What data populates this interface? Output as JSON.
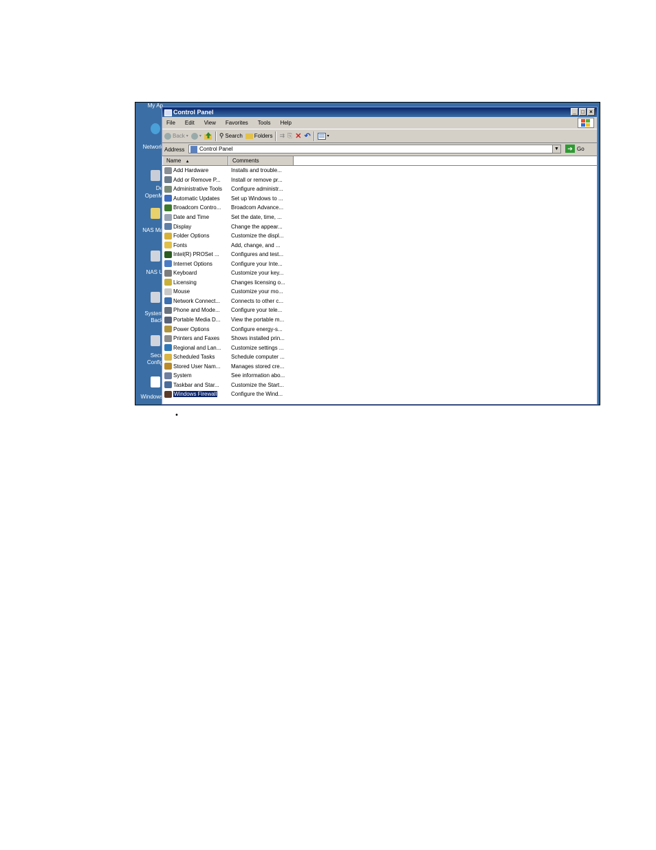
{
  "desktop": {
    "items": [
      "My Ap",
      "Network",
      "De",
      "OpenM",
      "NAS Ma",
      "NAS U",
      "System",
      "Back",
      "Secu",
      "Config",
      "Windows"
    ]
  },
  "window": {
    "title": "Control Panel",
    "controls": [
      "_",
      "□",
      "×"
    ]
  },
  "menu": [
    "File",
    "Edit",
    "View",
    "Favorites",
    "Tools",
    "Help"
  ],
  "toolbar": {
    "back": "Back",
    "search": "Search",
    "folders": "Folders"
  },
  "address": {
    "label": "Address",
    "value": "Control Panel",
    "go": "Go"
  },
  "columns": {
    "name": "Name",
    "comments": "Comments"
  },
  "items": [
    {
      "name": "Add Hardware",
      "comment": "Installs and trouble...",
      "icon": "hardware-icon",
      "color": "#8a8f96"
    },
    {
      "name": "Add or Remove P...",
      "comment": "Install or remove pr...",
      "icon": "add-remove-icon",
      "color": "#6d7d8c"
    },
    {
      "name": "Administrative Tools",
      "comment": "Configure administr...",
      "icon": "admin-tools-icon",
      "color": "#7b8b7b"
    },
    {
      "name": "Automatic Updates",
      "comment": "Set up Windows to ...",
      "icon": "updates-icon",
      "color": "#3d6cc0"
    },
    {
      "name": "Broadcom Contro...",
      "comment": "Broadcom Advance...",
      "icon": "broadcom-icon",
      "color": "#3c7a2d"
    },
    {
      "name": "Date and Time",
      "comment": "Set the date, time, ...",
      "icon": "clock-icon",
      "color": "#9aa4b2"
    },
    {
      "name": "Display",
      "comment": "Change the appear...",
      "icon": "display-icon",
      "color": "#5f7fa8"
    },
    {
      "name": "Folder Options",
      "comment": "Customize the displ...",
      "icon": "folder-options-icon",
      "color": "#d6b13a"
    },
    {
      "name": "Fonts",
      "comment": "Add, change, and ...",
      "icon": "fonts-icon",
      "color": "#e0c04a"
    },
    {
      "name": "Intel(R) PROSet ...",
      "comment": "Configures and test...",
      "icon": "intel-icon",
      "color": "#2c5b22"
    },
    {
      "name": "Internet Options",
      "comment": "Configure your Inte...",
      "icon": "internet-icon",
      "color": "#4b7bc4"
    },
    {
      "name": "Keyboard",
      "comment": "Customize your key...",
      "icon": "keyboard-icon",
      "color": "#7d7d7d"
    },
    {
      "name": "Licensing",
      "comment": "Changes licensing o...",
      "icon": "licensing-icon",
      "color": "#c9b03b"
    },
    {
      "name": "Mouse",
      "comment": "Customize your mo...",
      "icon": "mouse-icon",
      "color": "#c8c8c8"
    },
    {
      "name": "Network Connect...",
      "comment": "Connects to other c...",
      "icon": "network-icon",
      "color": "#3b6fb0"
    },
    {
      "name": "Phone and Mode...",
      "comment": "Configure your tele...",
      "icon": "phone-icon",
      "color": "#6a7280"
    },
    {
      "name": "Portable Media D...",
      "comment": "View the portable m...",
      "icon": "media-icon",
      "color": "#58637a"
    },
    {
      "name": "Power Options",
      "comment": "Configure energy-s...",
      "icon": "power-icon",
      "color": "#b09440"
    },
    {
      "name": "Printers and Faxes",
      "comment": "Shows installed prin...",
      "icon": "printer-icon",
      "color": "#8c8c8c"
    },
    {
      "name": "Regional and Lan...",
      "comment": "Customize settings ...",
      "icon": "globe-icon",
      "color": "#2f78b8"
    },
    {
      "name": "Scheduled Tasks",
      "comment": "Schedule computer ...",
      "icon": "tasks-icon",
      "color": "#d8b444"
    },
    {
      "name": "Stored User Nam...",
      "comment": "Manages stored cre...",
      "icon": "keys-icon",
      "color": "#b88a2a"
    },
    {
      "name": "System",
      "comment": "See information abo...",
      "icon": "system-icon",
      "color": "#6f7fa0"
    },
    {
      "name": "Taskbar and Star...",
      "comment": "Customize the Start...",
      "icon": "taskbar-icon",
      "color": "#4a6c9a"
    },
    {
      "name": "Windows Firewall",
      "comment": "Configure the Wind...",
      "icon": "firewall-icon",
      "color": "#5a3a2a",
      "selected": true
    }
  ],
  "page": {
    "bullet": "•"
  }
}
